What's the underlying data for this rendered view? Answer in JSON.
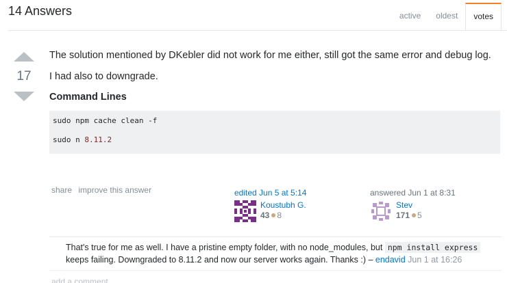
{
  "header": {
    "title": "14 Answers",
    "tabs": [
      {
        "label": "active"
      },
      {
        "label": "oldest"
      },
      {
        "label": "votes"
      }
    ]
  },
  "answer": {
    "vote_count": "17",
    "paragraphs": [
      "The solution mentioned by DKebler did not work for me either, still got the same error and debug log.",
      "I had also to downgrade."
    ],
    "heading": "Command Lines",
    "code": {
      "line1": "sudo npm cache clean -f",
      "line2_cmd": "sudo n ",
      "line2_version": "8.11.2"
    },
    "menu": {
      "share": "share",
      "improve": "improve this answer"
    },
    "edited": {
      "action": "edited Jun 5 at 5:14",
      "user": "Koustubh G.",
      "rep": "43",
      "bronze": "8",
      "avatar_color": "#7a2e8a"
    },
    "answered": {
      "action": "answered Jun 1 at 8:31",
      "user": "Stev",
      "rep": "171",
      "bronze": "5",
      "avatar_color": "#b99ad0"
    }
  },
  "comment": {
    "text_before": "That's true for me as well. I have a pristine empty folder, with no node_modules, but ",
    "code": "npm install express",
    "text_after": " keeps failing. Downgraded to 8.11.2 and now our server works again. Thanks :) – ",
    "user": "endavid",
    "date": "Jun 1 at 16:26"
  },
  "add_comment": "add a comment",
  "colors": {
    "accent": "#f48024",
    "link": "#0077cc",
    "code_bg": "#eff0f1",
    "bronze": "#cda77d"
  }
}
